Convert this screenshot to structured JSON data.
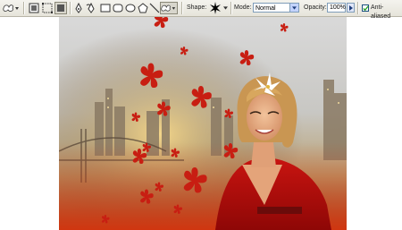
{
  "toolbar": {
    "shape_label": "Shape:",
    "mode_label": "Mode:",
    "mode_value": "Normal",
    "opacity_label": "Opacity:",
    "opacity_value": "100%",
    "anti_aliased_label": "Anti-aliased",
    "anti_aliased_checked": true,
    "icons": [
      "custom-shape-tool-icon",
      "shape-layers-icon",
      "paths-icon",
      "fill-pixels-icon",
      "pen-icon",
      "freeform-pen-icon",
      "rectangle-icon",
      "rounded-rectangle-icon",
      "ellipse-icon",
      "polygon-icon",
      "line-icon",
      "custom-shape-icon"
    ]
  },
  "colors": {
    "flower_red": "#c81e12",
    "dress_red": "#b80d0a",
    "skin": "#e5a57a",
    "hair": "#d2a25a"
  }
}
